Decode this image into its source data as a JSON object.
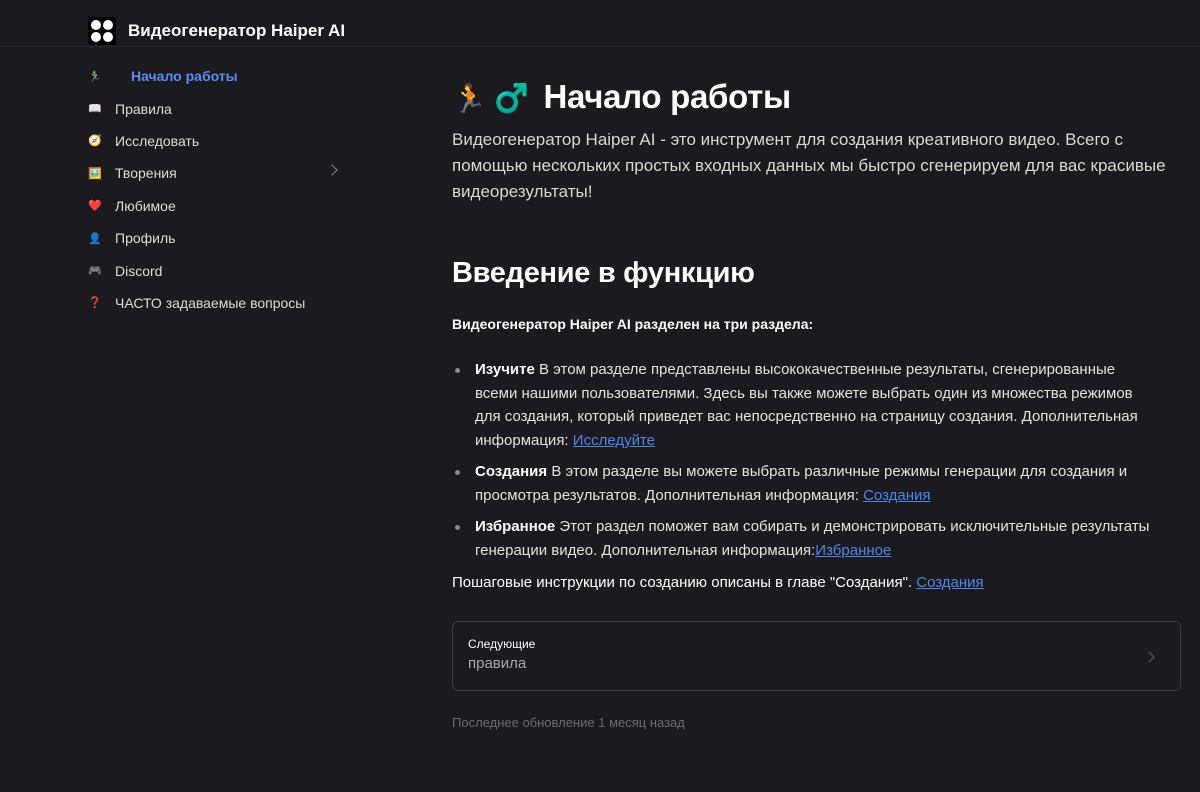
{
  "header": {
    "title": "Видеогенератор Haiper AI",
    "logo_icon": "haiper-logo-icon"
  },
  "sidebar": {
    "items": [
      {
        "icon": "🏃‍♂️",
        "label": "Начало работы",
        "active": true
      },
      {
        "icon": "📖",
        "label": "Правила"
      },
      {
        "icon": "🧭",
        "label": "Исследовать"
      },
      {
        "icon": "🖼️",
        "label": "Творения",
        "has_submenu": true
      },
      {
        "icon": "❤️",
        "label": "Любимое"
      },
      {
        "icon": "👤",
        "label": "Профиль"
      },
      {
        "icon": "🎮",
        "label": "Discord"
      },
      {
        "icon": "❓",
        "label": "ЧАСТО задаваемые вопросы"
      }
    ]
  },
  "main": {
    "title_emoji": "🏃 ♂️",
    "title": "Начало работы",
    "intro": "Видеогенератор Haiper AI - это инструмент для создания креативного видео. Всего с помощью нескольких простых входных данных мы быстро сгенерируем для вас красивые видеорезультаты!",
    "section_title": "Введение в функцию",
    "lead": "Видеогенератор Haiper AI разделен на три раздела:",
    "features": [
      {
        "term": "Изучите",
        "text": " В этом разделе представлены высококачественные результаты, сгенерированные всеми нашими пользователями. Здесь вы также можете выбрать один из множества режимов для создания, который приведет вас непосредственно на страницу создания. Дополнительная информация: ",
        "link": "Исследуйте"
      },
      {
        "term": "Создания",
        "text": " В этом разделе вы можете выбрать различные режимы генерации для создания и просмотра результатов. Дополнительная информация: ",
        "link": "Создания"
      },
      {
        "term": "Избранное",
        "text": " Этот раздел поможет вам собирать и демонстрировать исключительные результаты генерации видео. Дополнительная информация:",
        "link": "Избранное"
      }
    ],
    "steps_text": "Пошаговые инструкции по созданию описаны в главе \"Создания\". ",
    "steps_link": "Создания",
    "next": {
      "label": "Следующие",
      "title": "правила"
    },
    "last_updated": "Последнее обновление 1 месяц назад"
  },
  "colors": {
    "background": "#1b1b1f",
    "accent": "#5b8df0",
    "link": "#4f86e8"
  }
}
